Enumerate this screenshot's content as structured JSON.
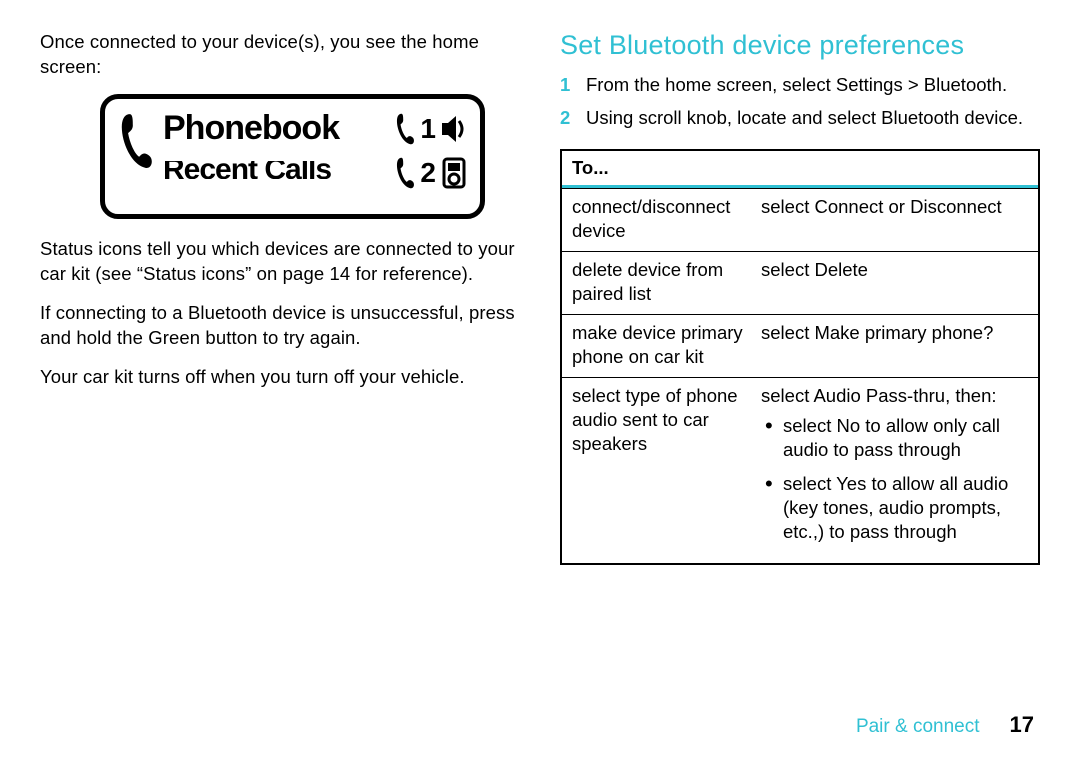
{
  "left": {
    "intro": "Once connected to your device(s), you see the home screen:",
    "device": {
      "title": "Phonebook",
      "subtitle_cut": "Recent Calls",
      "line1_num": "1",
      "line2_num": "2"
    },
    "p1": "Status icons tell you which devices are connected to your car kit (see “Status icons” on page 14 for reference).",
    "p2": "If connecting to a Bluetooth device is unsuccessful, press and hold the Green button to try again.",
    "p3": "Your car kit turns off when you turn off your vehicle."
  },
  "right": {
    "heading": "Set Bluetooth device preferences",
    "steps": [
      {
        "num": "1",
        "text": "From the home screen, select Settings > Bluetooth."
      },
      {
        "num": "2",
        "text": "Using scroll knob, locate and select Bluetooth device."
      }
    ],
    "table": {
      "header": "To...",
      "rows": [
        {
          "left": "connect/disconnect device",
          "right": "select Connect or Disconnect"
        },
        {
          "left": "delete device from paired list",
          "right": "select Delete"
        },
        {
          "left": "make device primary phone on car kit",
          "right": "select Make primary phone?"
        },
        {
          "left": "select type of phone audio sent to car speakers",
          "right": "select Audio Pass-thru, then:",
          "bullets": [
            "select No to allow only call audio to pass through",
            "select Yes to allow all audio (key tones, audio prompts, etc.,) to pass through"
          ]
        }
      ]
    }
  },
  "footer": {
    "section": "Pair & connect",
    "page": "17"
  }
}
